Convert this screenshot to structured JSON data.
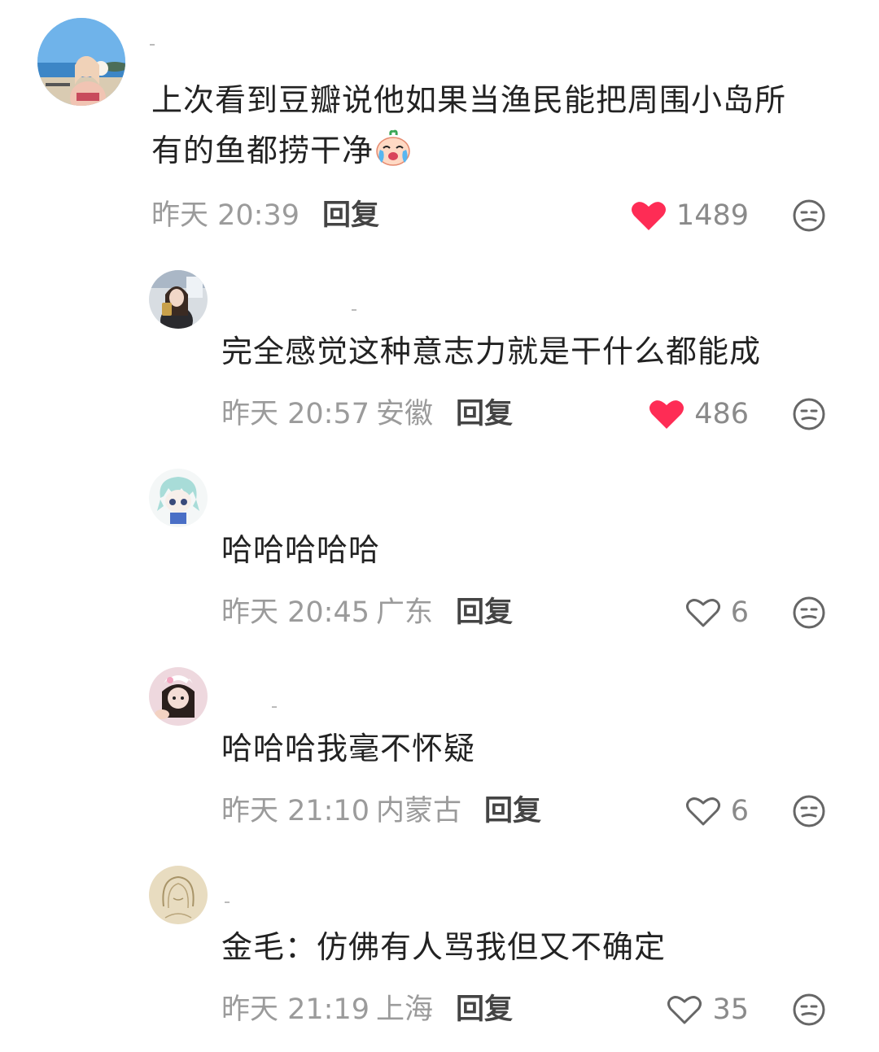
{
  "comments": [
    {
      "text": "上次看到豆瓣说他如果当渔民能把周围小岛所有的鱼都捞干净",
      "line1": "上次看到豆瓣说他如果当渔民能把周围小岛所",
      "line2": "有的鱼都捞干净",
      "emoji": "crying-face-emoji",
      "time": "昨天 20:39",
      "location": "",
      "reply_label": "回复",
      "likes": "1489",
      "liked": true
    },
    {
      "text": "完全感觉这种意志力就是干什么都能成",
      "time": "昨天 20:57",
      "location": "安徽",
      "reply_label": "回复",
      "likes": "486",
      "liked": true
    },
    {
      "text": "哈哈哈哈哈",
      "time": "昨天 20:45",
      "location": "广东",
      "reply_label": "回复",
      "likes": "6",
      "liked": false
    },
    {
      "text": "哈哈哈我毫不怀疑",
      "time": "昨天 21:10",
      "location": "内蒙古",
      "reply_label": "回复",
      "likes": "6",
      "liked": false
    },
    {
      "text": "金毛：仿佛有人骂我但又不确定",
      "time": "昨天 21:19",
      "location": "上海",
      "reply_label": "回复",
      "likes": "35",
      "liked": false
    }
  ],
  "colors": {
    "like_active": "#fe2c55",
    "like_inactive": "#8a8a8a",
    "text": "#222222",
    "meta": "#9b9b9b"
  },
  "icons": {
    "like": "heart-icon",
    "dislike": "unamused-face-icon"
  }
}
